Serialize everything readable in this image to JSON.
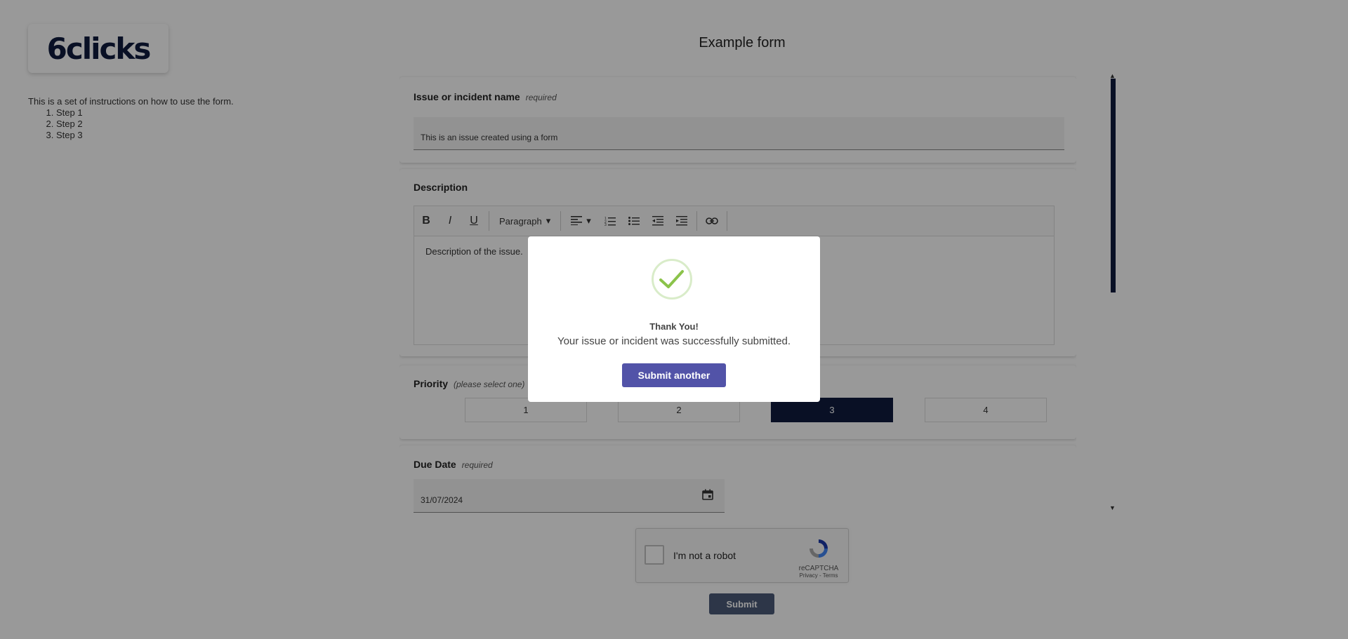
{
  "brand": {
    "logo_text": "6clicks"
  },
  "instructions": {
    "intro": "This is a set of instructions on how to use the form.",
    "steps": [
      "Step 1",
      "Step 2",
      "Step 3"
    ]
  },
  "form": {
    "title": "Example form",
    "issue_name": {
      "label": "Issue or incident name",
      "required_text": "required",
      "value": "This is an issue created using a form"
    },
    "description": {
      "label": "Description",
      "toolbar": {
        "bold": "B",
        "italic": "I",
        "underline": "U",
        "paragraph_label": "Paragraph"
      },
      "value": "Description of the issue."
    },
    "priority": {
      "label": "Priority",
      "hint": "(please select one)",
      "options": [
        "1",
        "2",
        "3",
        "4"
      ],
      "selected": "3"
    },
    "due_date": {
      "label": "Due Date",
      "required_text": "required",
      "value": "31/07/2024"
    }
  },
  "captcha": {
    "label": "I'm not a robot",
    "brand": "reCAPTCHA",
    "links": "Privacy - Terms"
  },
  "submit_label": "Submit",
  "modal": {
    "title": "Thank You!",
    "message": "Your issue or incident was successfully submitted.",
    "button_label": "Submit another",
    "check_color": "#8bc34a"
  },
  "colors": {
    "accent_dark": "#0f1c3f",
    "modal_button": "#5253a8"
  }
}
